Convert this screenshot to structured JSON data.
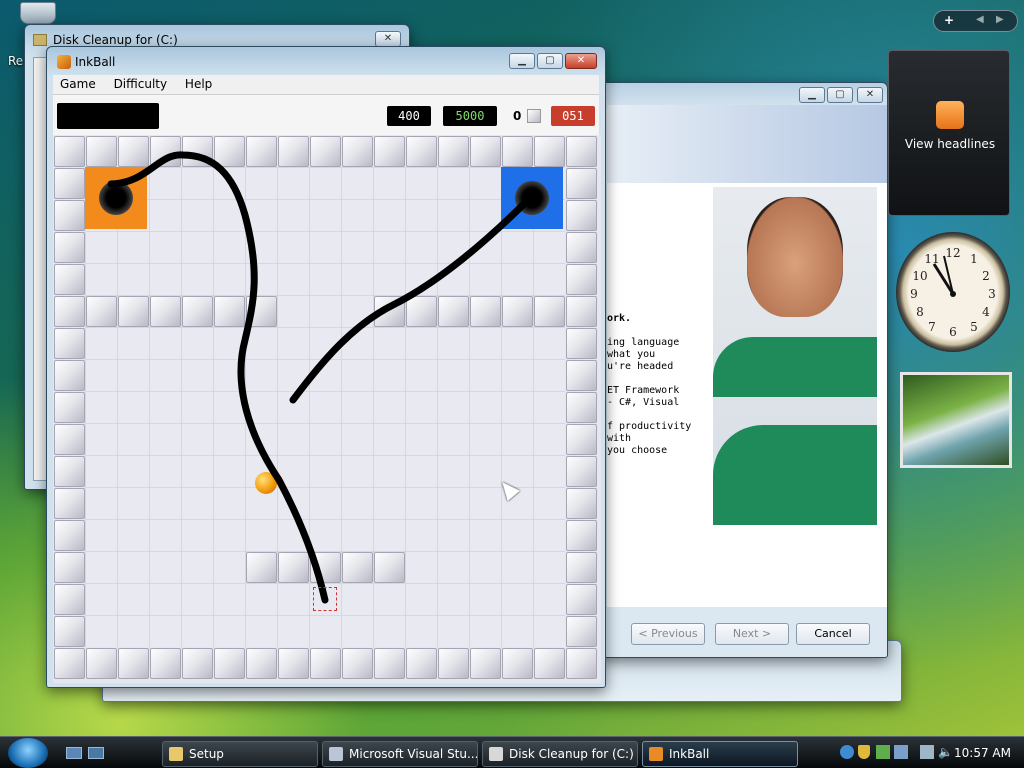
{
  "desktop": {
    "recycle_label": "Re"
  },
  "disk_cleanup": {
    "title": "Disk Cleanup for  (C:)",
    "close": "✕"
  },
  "inkball": {
    "title": "InkBall",
    "menus": [
      "Game",
      "Difficulty",
      "Help"
    ],
    "counters": {
      "score": "400",
      "bonus": "5000",
      "balls": "0",
      "time": "051"
    },
    "colors": {
      "orange_goal": "#f28b1c",
      "blue_goal": "#1e6fe8",
      "ink": "#000000",
      "ball": "#f39b0b"
    }
  },
  "setup": {
    "text_lines": [
      "ork.",
      "",
      "ing language",
      "what you",
      "u're headed",
      "",
      "ET Framework",
      " - C#, Visual",
      "",
      "f productivity",
      " with",
      " you choose"
    ],
    "buttons": {
      "previous": "< Previous",
      "next": "Next >",
      "cancel": "Cancel"
    }
  },
  "gadgets": {
    "feed_label": "View headlines"
  },
  "taskbar": {
    "items": [
      {
        "label": "Setup"
      },
      {
        "label": "Microsoft Visual Stu..."
      },
      {
        "label": "Disk Cleanup for  (C:)"
      },
      {
        "label": "InkBall"
      }
    ],
    "time": "10:57 AM"
  }
}
